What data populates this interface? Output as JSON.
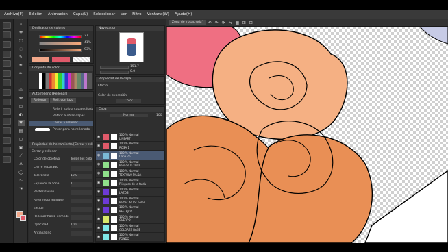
{
  "menu": [
    "Archivo(F)",
    "Edición",
    "Animación",
    "Capa(L)",
    "Seleccionar",
    "Ver",
    "Filtro",
    "Ventana(W)",
    "Ayuda(H)"
  ],
  "color_panel": {
    "title": "Deslizador de colores",
    "values": [
      "27",
      "41%",
      "93%"
    ]
  },
  "swatch_panel": {
    "title": "Conjunto de color"
  },
  "subtool": {
    "title": "Autorrelleno [Rellenar]",
    "tabs": [
      "Rellenar",
      "Rell. con lazo"
    ],
    "items": [
      "Referir solo a capa editada",
      "Referir a otras capas",
      "Cerrar y rellenar",
      "Pintar para no rellenado"
    ]
  },
  "tool_property": {
    "title": "Propiedad de herramienta [Cerrar y rellenar]",
    "subtitle": "Cerrar y rellenar",
    "rows": [
      {
        "label": "Color de objetivo",
        "value": "Todos los colores"
      },
      {
        "label": "Cierre separado",
        "value": ""
      },
      {
        "label": "Tolerancia",
        "value": "10.0"
      },
      {
        "label": "Expandir la zona",
        "value": "1"
      },
      {
        "label": "Rasterización",
        "value": ""
      },
      {
        "label": "Referencia múltiple",
        "value": ""
      },
      {
        "label": "Excluir",
        "value": ""
      },
      {
        "label": "Rellenar hasta el medio del vector",
        "value": ""
      },
      {
        "label": "Opacidad",
        "value": "100"
      },
      {
        "label": "Antialiasing",
        "value": ""
      }
    ]
  },
  "navigator": {
    "title": "Navegador",
    "zoom": "151.7",
    "angle": "0.0"
  },
  "layer_property": {
    "title": "Propiedad de la capa",
    "effect": "Efecto",
    "color_label": "Color de expresión",
    "color_value": "Color"
  },
  "layers_panel": {
    "title": "Capa",
    "blend": "Normal",
    "opacity": "100",
    "layers": [
      {
        "pct": "100 % Normal",
        "name": "LINEART",
        "color": "#e05a6a"
      },
      {
        "pct": "100 % Normal",
        "name": "ROSA 1",
        "color": "#e05a6a"
      },
      {
        "pct": "100 % Normal",
        "name": "Capa 76",
        "color": "#7ab8d6"
      },
      {
        "pct": "100 % Normal",
        "name": "Pelo de la falda",
        "color": "#8fe08a"
      },
      {
        "pct": "100 % Normal",
        "name": "TEXTURA FALDA",
        "color": "#8fe08a"
      },
      {
        "pct": "100 % Normal",
        "name": "Pliegues de la falda",
        "color": "#8fe08a"
      },
      {
        "pct": "100 % Normal",
        "name": "LAZOS",
        "color": "#6d3ad6"
      },
      {
        "pct": "100 % Normal",
        "name": "Partes de los pelos",
        "color": "#6d3ad6"
      },
      {
        "pct": "100 % Normal",
        "name": "REFLEJOS",
        "color": "#6d3ad6"
      },
      {
        "pct": "100 % Normal",
        "name": "CUERPO",
        "color": "#d8e86a"
      },
      {
        "pct": "100 % Normal",
        "name": "COLORES BASE",
        "color": "#7fe8e8"
      },
      {
        "pct": "100 % Normal",
        "name": "FONDO",
        "color": "#7fe8e8"
      }
    ]
  },
  "canvas_tab": "Zona de 'rosacruda'"
}
